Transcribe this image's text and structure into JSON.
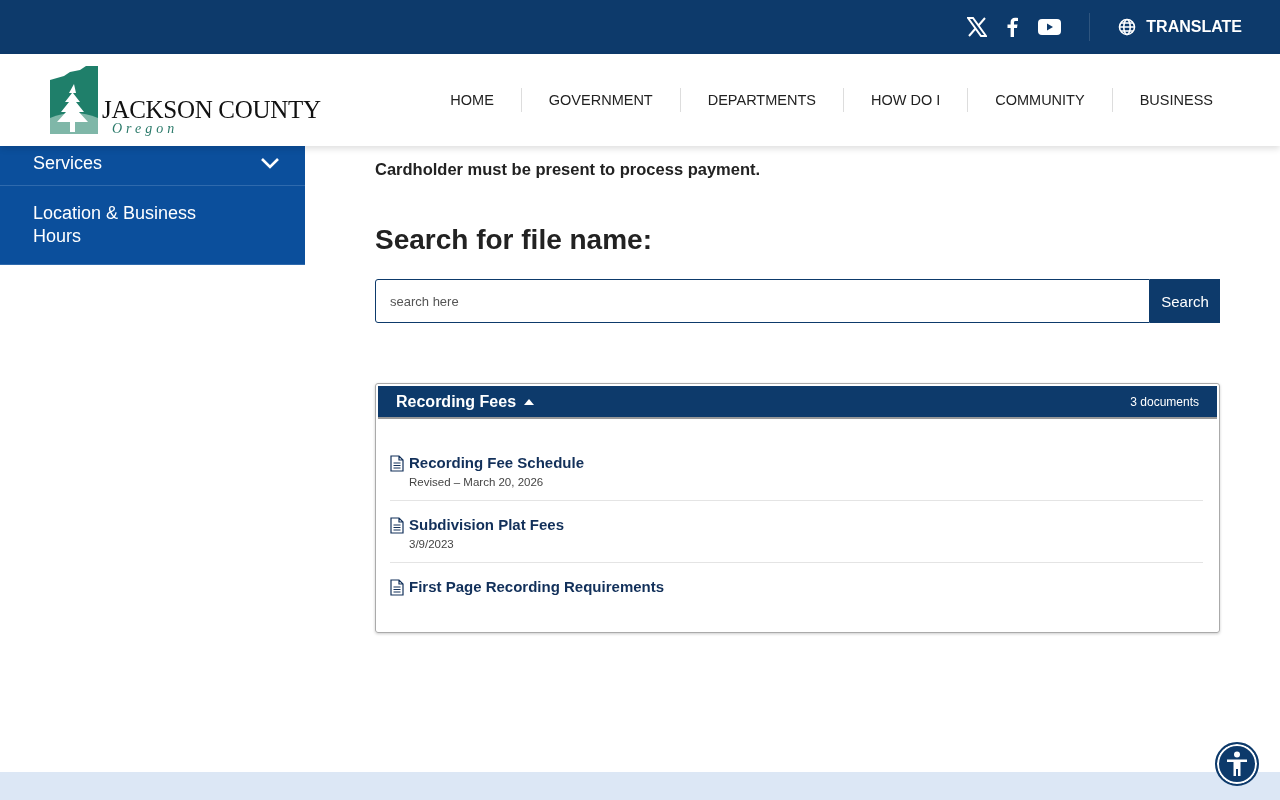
{
  "top_bar": {
    "social": [
      {
        "kind": "x"
      },
      {
        "kind": "facebook"
      },
      {
        "kind": "youtube"
      }
    ],
    "translate": "TRANSLATE"
  },
  "header": {
    "logo": {
      "name": "JACKSON COUNTY",
      "state": "Oregon"
    },
    "nav": [
      {
        "label": "HOME"
      },
      {
        "label": "GOVERNMENT"
      },
      {
        "label": "DEPARTMENTS"
      },
      {
        "label": "HOW DO I"
      },
      {
        "label": "COMMUNITY"
      },
      {
        "label": "BUSINESS"
      }
    ]
  },
  "sidebar": {
    "items": [
      {
        "kind": "toggle",
        "label": "Services",
        "expanded": false
      },
      {
        "kind": "link",
        "label": "Location & Business Hours"
      }
    ]
  },
  "content": {
    "notice": "Cardholder must be present to process payment.",
    "search_heading": "Search for file name:",
    "search": {
      "placeholder": "search here",
      "button": "Search"
    },
    "folder": {
      "title": "Recording Fees",
      "expanded": true,
      "count": "3 documents",
      "documents": [
        {
          "title": "Recording Fee Schedule",
          "meta": "Revised – March 20, 2026"
        },
        {
          "title": "Subdivision Plat Fees",
          "meta": "3/9/2023"
        },
        {
          "title": "First Page Recording Requirements"
        }
      ]
    }
  }
}
